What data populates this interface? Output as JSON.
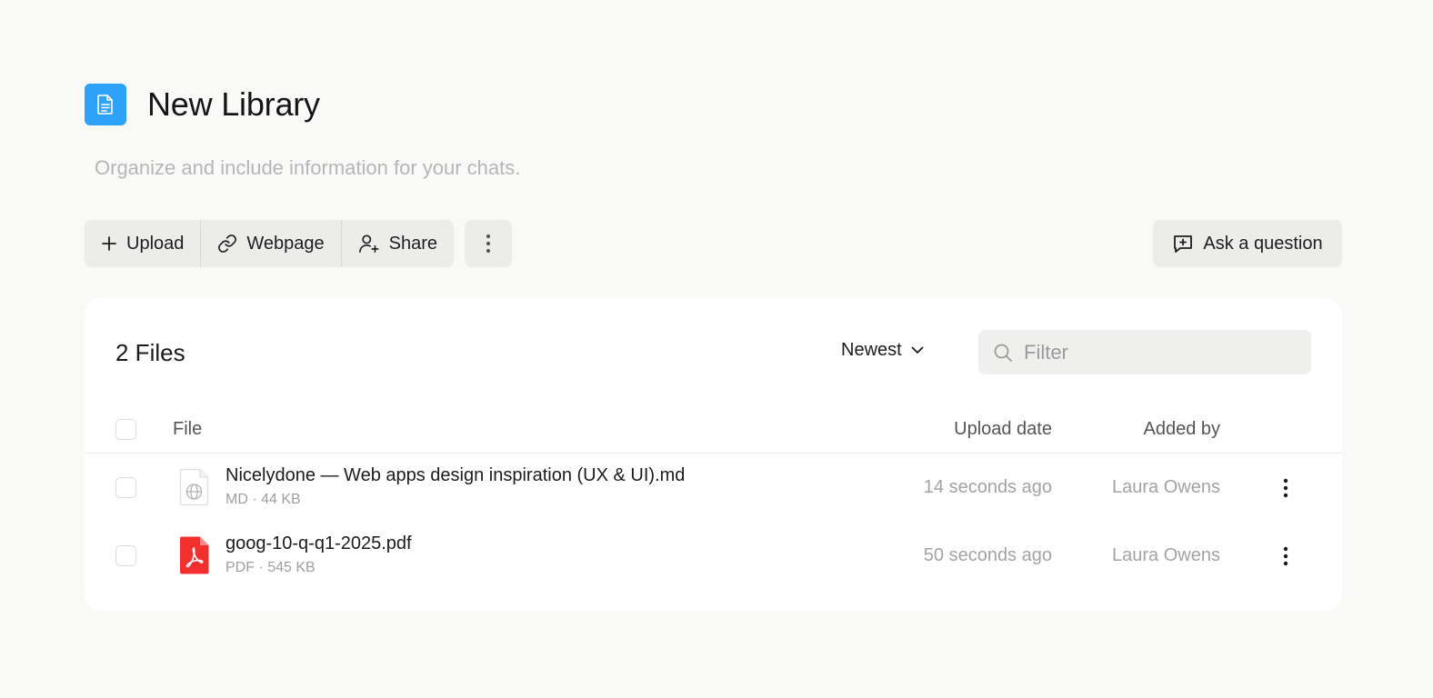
{
  "header": {
    "title": "New Library",
    "subtitle": "Organize and include information for your chats.",
    "icon": "document-icon",
    "accent_color": "#2ea2f8"
  },
  "toolbar": {
    "upload_label": "Upload",
    "webpage_label": "Webpage",
    "share_label": "Share",
    "ask_label": "Ask a question"
  },
  "files": {
    "count_label": "2 Files",
    "sort_label": "Newest",
    "filter_placeholder": "Filter",
    "columns": {
      "file": "File",
      "upload_date": "Upload date",
      "added_by": "Added by"
    },
    "rows": [
      {
        "name": "Nicelydone — Web apps design inspiration (UX & UI).md",
        "meta": "MD · 44 KB",
        "upload_date": "14 seconds ago",
        "added_by": "Laura Owens",
        "icon": "web-document-icon"
      },
      {
        "name": "goog-10-q-q1-2025.pdf",
        "meta": "PDF · 545 KB",
        "upload_date": "50 seconds ago",
        "added_by": "Laura Owens",
        "icon": "pdf-file-icon",
        "icon_color": "#f23030"
      }
    ]
  }
}
